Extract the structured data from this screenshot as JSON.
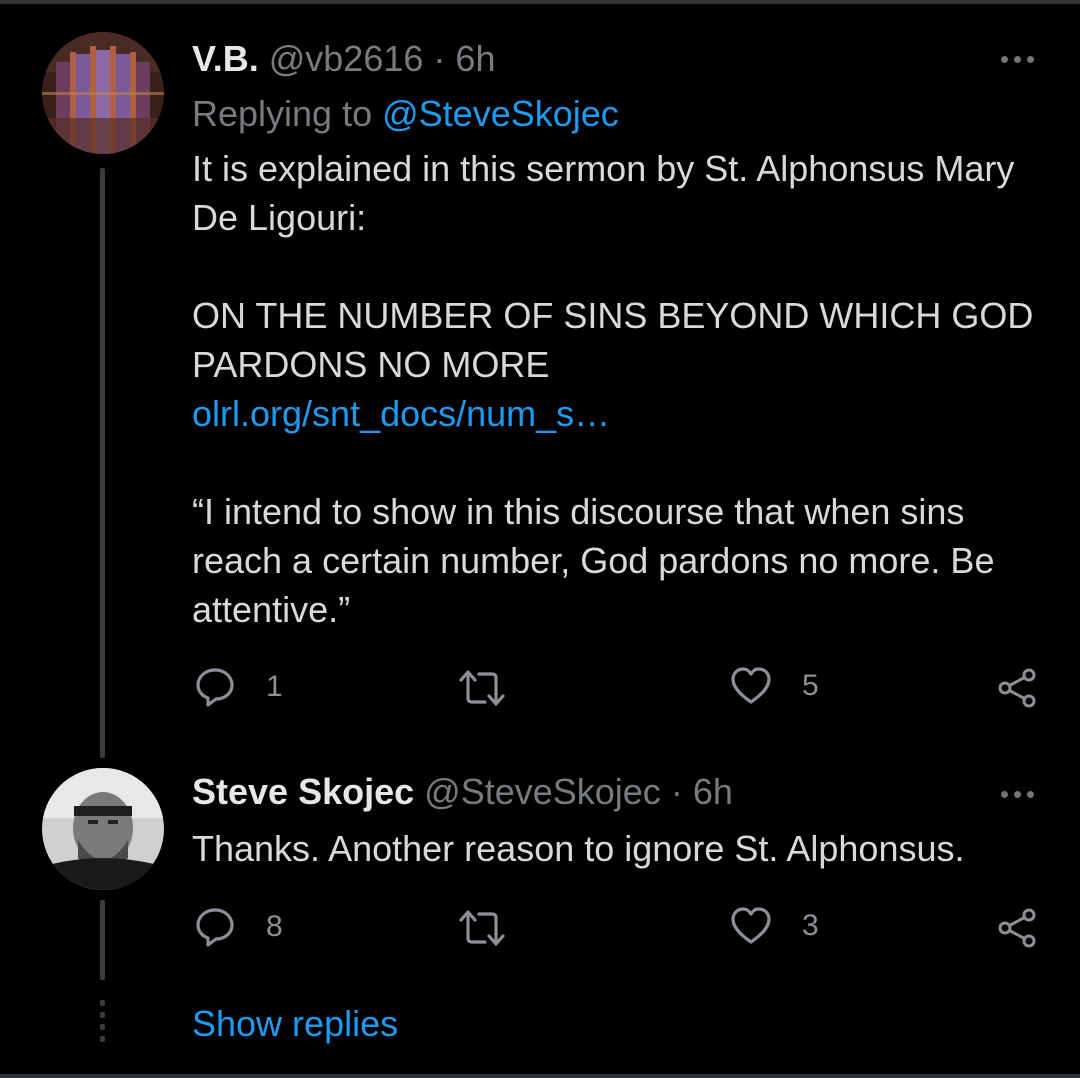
{
  "colors": {
    "background": "#000000",
    "text": "#d9d9d9",
    "muted": "#767b80",
    "link": "#1d9bf0",
    "thread_line": "#3a3d40"
  },
  "tweets": [
    {
      "name": "V.B.",
      "handle": "@vb2616",
      "separator": "·",
      "time": "6h",
      "replying_prefix": "Replying to",
      "replying_to": "@SteveSkojec",
      "text_lines": [
        "It is explained in this sermon by St. Alphonsus Mary",
        "De Ligouri:",
        "ON THE NUMBER OF SINS BEYOND WHICH GOD",
        "PARDONS NO MORE"
      ],
      "link_text": "olrl.org/snt_docs/num_s…",
      "quote_lines": [
        " “I intend to show in this discourse that when sins",
        "reach a certain number, God pardons no more. Be",
        "attentive.”"
      ],
      "reply_count": "1",
      "like_count": "5",
      "avatar_icon": "cathedral-stained-glass-avatar"
    },
    {
      "name": "Steve Skojec",
      "handle": "@SteveSkojec",
      "separator": "·",
      "time": "6h",
      "text_lines": [
        "Thanks. Another reason to ignore St. Alphonsus."
      ],
      "reply_count": "8",
      "like_count": "3",
      "avatar_icon": "bearded-man-bw-avatar"
    }
  ],
  "show_replies_label": "Show replies",
  "icons": {
    "more": "more-horizontal-icon",
    "reply": "reply-bubble-icon",
    "retweet": "retweet-icon",
    "like": "heart-icon",
    "share": "share-icon"
  }
}
